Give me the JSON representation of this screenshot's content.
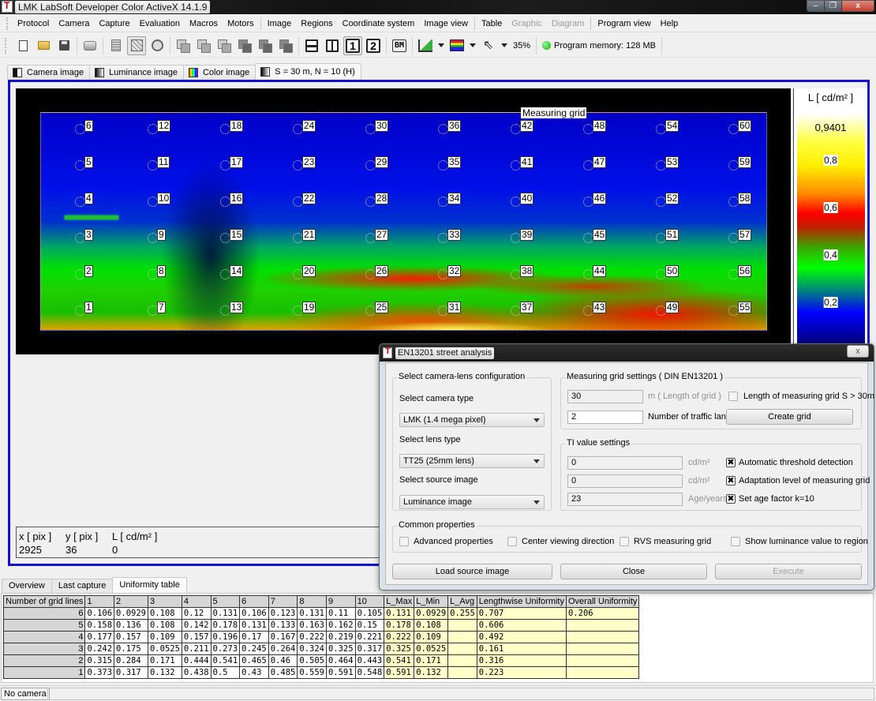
{
  "window": {
    "title": "LMK LabSoft Developer Color ActiveX  14.1.9",
    "controls": {
      "minimize": "–",
      "restore": "❐",
      "close": "x"
    }
  },
  "menubar": {
    "items": [
      {
        "label": "Protocol",
        "disabled": false
      },
      {
        "label": "Camera",
        "disabled": false
      },
      {
        "label": "Capture",
        "disabled": false
      },
      {
        "label": "Evaluation",
        "disabled": false
      },
      {
        "label": "Macros",
        "disabled": false
      },
      {
        "label": "Motors",
        "disabled": false
      },
      {
        "label": "Image",
        "disabled": false
      },
      {
        "label": "Regions",
        "disabled": false
      },
      {
        "label": "Coordinate system",
        "disabled": false
      },
      {
        "label": "Image view",
        "disabled": false
      },
      {
        "label": "Table",
        "disabled": false
      },
      {
        "label": "Graphic",
        "disabled": true
      },
      {
        "label": "Diagram",
        "disabled": true
      },
      {
        "label": "Program view",
        "disabled": false
      },
      {
        "label": "Help",
        "disabled": false
      }
    ]
  },
  "toolbar": {
    "icons": [
      "new-document-icon",
      "open-folder-icon",
      "save-icon",
      "print-icon",
      "capture-film-icon",
      "grid-region-icon",
      "timer-capture-icon",
      "stack-1-icon",
      "stack-2-icon",
      "stack-3-icon",
      "stack-4-icon",
      "stack-5-icon",
      "stack-6-icon",
      "horizontal-split-icon",
      "vertical-split-icon",
      "view-1-icon",
      "view-2-icon",
      "bm-icon",
      "linear-scale-icon",
      "color-palette-icon",
      "pointer-icon"
    ],
    "view1_label": "1",
    "view2_label": "2",
    "bm_label": "BM",
    "zoom": "35%",
    "memory": "Program memory: 128 MB"
  },
  "image_tabs": [
    {
      "label": "Camera image",
      "icon": "camera-image-icon"
    },
    {
      "label": "Luminance image",
      "icon": "luminance-image-icon"
    },
    {
      "label": "Color image",
      "icon": "color-image-icon"
    },
    {
      "label": "S = 30 m, N = 10 (H)",
      "icon": "luminance-image-icon",
      "selected": true
    }
  ],
  "image_view": {
    "grid_title": "Measuring grid",
    "grid_columns": 10,
    "grid_rows": 6,
    "point_labels": [
      "1",
      "2",
      "3",
      "4",
      "5",
      "6",
      "7",
      "8",
      "9",
      "10",
      "11",
      "12",
      "13",
      "14",
      "15",
      "16",
      "17",
      "18",
      "19",
      "20",
      "21",
      "22",
      "23",
      "24",
      "25",
      "26",
      "27",
      "28",
      "29",
      "30",
      "31",
      "32",
      "33",
      "34",
      "35",
      "36",
      "37",
      "38",
      "39",
      "40",
      "41",
      "42",
      "43",
      "44",
      "45",
      "46",
      "47",
      "48",
      "49",
      "50",
      "51",
      "52",
      "53",
      "54",
      "55",
      "56",
      "57",
      "58",
      "59",
      "60"
    ],
    "scale": {
      "unit": "L [ cd/m² ]",
      "max": "0,9401",
      "ticks": [
        {
          "label": "0,8",
          "value": 0.8
        },
        {
          "label": "0,6",
          "value": 0.6
        },
        {
          "label": "0,4",
          "value": 0.4
        },
        {
          "label": "0,2",
          "value": 0.2
        }
      ]
    },
    "readout": {
      "x_label": "x [ pix ]",
      "y_label": "y [ pix ]",
      "l_label": "L [ cd/m² ]",
      "x": "2925",
      "y": "36",
      "l": "0"
    }
  },
  "bottom_tabs": [
    {
      "label": "Overview"
    },
    {
      "label": "Last capture"
    },
    {
      "label": "Uniformity table",
      "selected": true
    }
  ],
  "uniformity_table": {
    "headers": [
      "Number of grid lines",
      "1",
      "2",
      "3",
      "4",
      "5",
      "6",
      "7",
      "8",
      "9",
      "10",
      "L_Max",
      "L_Min",
      "L_Avg",
      "Lengthwise Uniformity",
      "Overall Uniformity"
    ],
    "rows": [
      {
        "line": "6",
        "values": [
          "0.106",
          "0.0929",
          "0.108",
          "0.12",
          "0.131",
          "0.106",
          "0.123",
          "0.131",
          "0.11",
          "0.105"
        ],
        "lmax": "0.131",
        "lmin": "0.0929",
        "lavg": "0.255",
        "lengthwise": "0.707",
        "overall": "0.206"
      },
      {
        "line": "5",
        "values": [
          "0.158",
          "0.136",
          "0.108",
          "0.142",
          "0.178",
          "0.131",
          "0.133",
          "0.163",
          "0.162",
          "0.15"
        ],
        "lmax": "0.178",
        "lmin": "0.108",
        "lavg": "",
        "lengthwise": "0.606",
        "overall": ""
      },
      {
        "line": "4",
        "values": [
          "0.177",
          "0.157",
          "0.109",
          "0.157",
          "0.196",
          "0.17",
          "0.167",
          "0.222",
          "0.219",
          "0.221"
        ],
        "lmax": "0.222",
        "lmin": "0.109",
        "lavg": "",
        "lengthwise": "0.492",
        "overall": ""
      },
      {
        "line": "3",
        "values": [
          "0.242",
          "0.175",
          "0.0525",
          "0.211",
          "0.273",
          "0.245",
          "0.264",
          "0.324",
          "0.325",
          "0.317"
        ],
        "lmax": "0.325",
        "lmin": "0.0525",
        "lavg": "",
        "lengthwise": "0.161",
        "overall": ""
      },
      {
        "line": "2",
        "values": [
          "0.315",
          "0.284",
          "0.171",
          "0.444",
          "0.541",
          "0.465",
          "0.46",
          "0.505",
          "0.464",
          "0.443"
        ],
        "lmax": "0.541",
        "lmin": "0.171",
        "lavg": "",
        "lengthwise": "0.316",
        "overall": ""
      },
      {
        "line": "1",
        "values": [
          "0.373",
          "0.317",
          "0.132",
          "0.438",
          "0.5",
          "0.43",
          "0.485",
          "0.559",
          "0.591",
          "0.548"
        ],
        "lmax": "0.591",
        "lmin": "0.132",
        "lavg": "",
        "lengthwise": "0.223",
        "overall": ""
      }
    ]
  },
  "statusbar": {
    "camera": "No camera"
  },
  "dialog": {
    "title": "EN13201 street analysis",
    "close": "x",
    "camera_lens": {
      "legend": "Select camera-lens configuration",
      "camera_type_label": "Select camera type",
      "camera_type": "LMK (1.4 mega pixel)",
      "lens_type_label": "Select lens type",
      "lens_type": "TT25 (25mm lens)",
      "source_label": "Select source image",
      "source": "Luminance image"
    },
    "grid_settings": {
      "legend": "Measuring grid settings ( DIN EN13201 )",
      "length": "30",
      "length_unit": "m ( Length of grid )",
      "long_grid_label": "Length of measuring grid S > 30m",
      "long_grid_checked": false,
      "lanes": "2",
      "lanes_label": "Number of traffic lane",
      "create_grid": "Create grid"
    },
    "ti_settings": {
      "legend": "TI value settings",
      "threshold": "0",
      "threshold_unit": "cd/m²",
      "auto_threshold_label": "Automatic threshold detection",
      "auto_threshold_checked": true,
      "adaptation": "0",
      "adaptation_unit": "cd/m²",
      "adaptation_label": "Adaptation level of measuring grid",
      "adaptation_checked": true,
      "age": "23",
      "age_unit": "Age/years",
      "age_factor_label": "Set age factor k=10",
      "age_factor_checked": true
    },
    "common": {
      "legend": "Common properties",
      "advanced": "Advanced properties",
      "center_view": "Center viewing direction",
      "rvs": "RVS measuring grid",
      "show_lum": "Show luminance value to region"
    },
    "buttons": {
      "load": "Load source image",
      "close": "Close",
      "execute": "Execute"
    },
    "check_mark": "✖"
  }
}
